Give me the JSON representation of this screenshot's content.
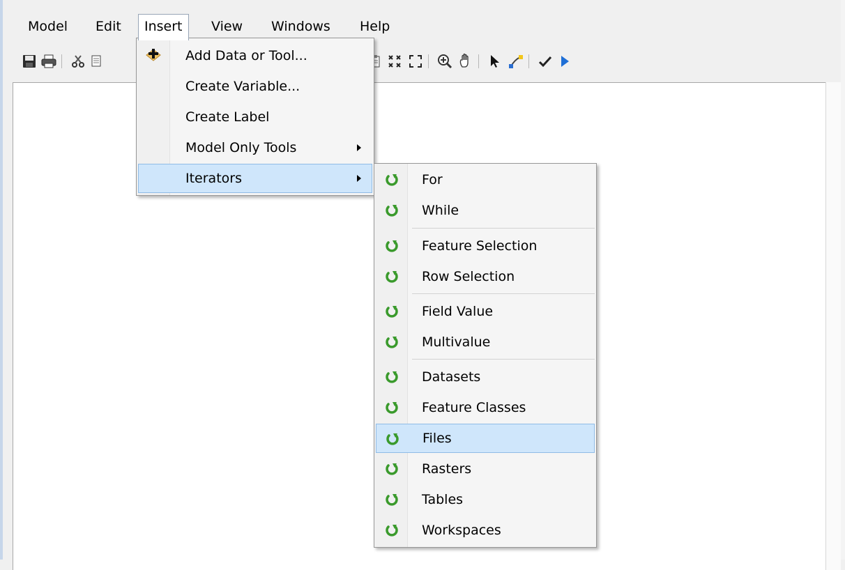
{
  "menubar": {
    "items": [
      "Model",
      "Edit",
      "Insert",
      "View",
      "Windows",
      "Help"
    ],
    "active": "Insert"
  },
  "toolbar": {
    "icons": [
      "save-icon",
      "print-icon",
      "cut-icon",
      "copy-icon",
      "paste-icon",
      "auto-layout-icon",
      "full-extent-icon",
      "fixed-zoom-icon",
      "zoom-in-icon",
      "pan-icon",
      "select-icon",
      "connect-icon",
      "validate-icon",
      "run-icon"
    ]
  },
  "insert_menu": {
    "items": [
      {
        "label": "Add Data or Tool...",
        "icon": "add-data-icon"
      },
      {
        "label": "Create Variable..."
      },
      {
        "label": "Create Label"
      },
      {
        "label": "Model Only Tools",
        "submenu": true
      },
      {
        "label": "Iterators",
        "submenu": true,
        "highlighted": true
      }
    ]
  },
  "iterators_menu": {
    "items": [
      {
        "label": "For"
      },
      {
        "label": "While"
      },
      {
        "label": "Feature Selection"
      },
      {
        "label": "Row Selection"
      },
      {
        "label": "Field Value"
      },
      {
        "label": "Multivalue"
      },
      {
        "label": "Datasets"
      },
      {
        "label": "Feature Classes"
      },
      {
        "label": "Files",
        "highlighted": true
      },
      {
        "label": "Rasters"
      },
      {
        "label": "Tables"
      },
      {
        "label": "Workspaces"
      }
    ]
  },
  "colors": {
    "highlight_bg": "#cfe6fb",
    "highlight_border": "#8fbbe6",
    "iterator_icon_green": "#3a9a2c",
    "menu_bg": "#f5f5f5"
  }
}
